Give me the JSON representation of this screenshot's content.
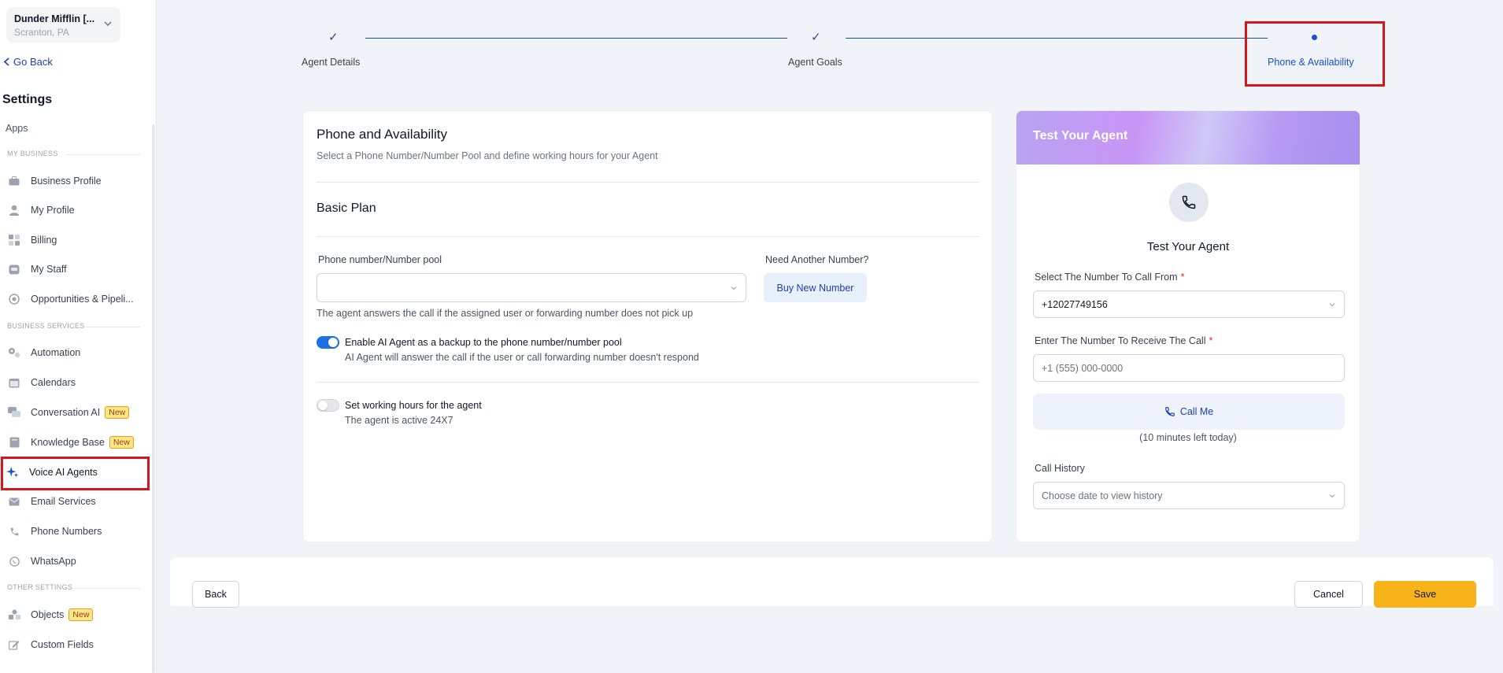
{
  "account": {
    "name": "Dunder Mifflin [...",
    "location": "Scranton, PA"
  },
  "nav": {
    "go_back": "Go Back",
    "settings_title": "Settings",
    "apps": "Apps",
    "section_my_business": "MY BUSINESS",
    "section_business_services": "BUSINESS SERVICES",
    "section_other_settings": "OTHER SETTINGS",
    "badge_new": "New",
    "items": [
      {
        "label": "Business Profile",
        "icon": "briefcase-icon"
      },
      {
        "label": "My Profile",
        "icon": "user-icon"
      },
      {
        "label": "Billing",
        "icon": "grid-icon"
      },
      {
        "label": "My Staff",
        "icon": "staff-icon"
      },
      {
        "label": "Opportunities & Pipeli...",
        "icon": "target-icon"
      },
      {
        "label": "Automation",
        "icon": "gears-icon"
      },
      {
        "label": "Calendars",
        "icon": "calendar-icon"
      },
      {
        "label": "Conversation AI",
        "icon": "chat-icon",
        "badge": "New"
      },
      {
        "label": "Knowledge Base",
        "icon": "book-icon",
        "badge": "New"
      },
      {
        "label": "Voice AI Agents",
        "icon": "sparkle-icon",
        "selected": true
      },
      {
        "label": "Email Services",
        "icon": "email-icon"
      },
      {
        "label": "Phone Numbers",
        "icon": "phone-icon"
      },
      {
        "label": "WhatsApp",
        "icon": "whatsapp-icon"
      },
      {
        "label": "Objects",
        "icon": "objects-icon",
        "badge": "New"
      },
      {
        "label": "Custom Fields",
        "icon": "edit-icon"
      }
    ]
  },
  "stepper": {
    "steps": [
      {
        "label": "Agent Details",
        "state": "complete"
      },
      {
        "label": "Agent Goals",
        "state": "complete"
      },
      {
        "label": "Phone & Availability",
        "state": "active"
      }
    ]
  },
  "main": {
    "title": "Phone and Availability",
    "subtitle": "Select a Phone Number/Number Pool and define working hours for your Agent",
    "plan": "Basic Plan",
    "phone_label": "Phone number/Number pool",
    "phone_value": "",
    "phone_help": "The agent answers the call if the assigned user or forwarding number does not pick up",
    "need_another": "Need Another Number?",
    "buy_button": "Buy New Number",
    "backup_toggle": {
      "title": "Enable AI Agent as a backup to the phone number/number pool",
      "desc": "AI Agent will answer the call if the user or call forwarding number doesn't respond",
      "on": true
    },
    "hours_toggle": {
      "title": "Set working hours for the agent",
      "desc": "The agent is active 24X7",
      "on": false
    }
  },
  "test_panel": {
    "header": "Test Your Agent",
    "title": "Test Your Agent",
    "from_label": "Select The Number To Call From",
    "from_value": "+12027749156",
    "to_label": "Enter The Number To Receive The Call",
    "to_placeholder": "+1 (555) 000-0000",
    "call_button": "Call Me",
    "minutes_left": "(10 minutes left today)",
    "history_label": "Call History",
    "history_placeholder": "Choose date to view history",
    "required_mark": "*"
  },
  "footer": {
    "back": "Back",
    "cancel": "Cancel",
    "save": "Save"
  },
  "colors": {
    "accent": "#1d4ed8",
    "save": "#f9b31a",
    "highlight": "#d4161e"
  }
}
